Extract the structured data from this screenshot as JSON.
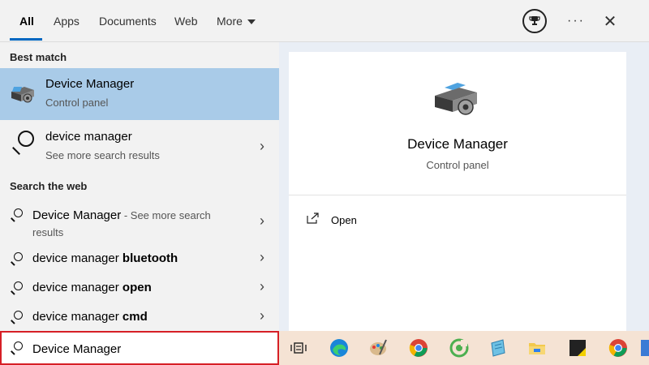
{
  "tabs": [
    {
      "label": "All",
      "active": true
    },
    {
      "label": "Apps"
    },
    {
      "label": "Documents"
    },
    {
      "label": "Web"
    },
    {
      "label": "More"
    }
  ],
  "top_icons": [
    "trophy-icon",
    "more-options-icon",
    "close-icon"
  ],
  "best_match": {
    "header": "Best match",
    "title": "Device Manager",
    "subtitle": "Control panel",
    "icon": "device-manager-icon"
  },
  "search_suggestion": {
    "title": "device manager",
    "subtitle": "See more search results"
  },
  "web": {
    "header": "Search the web",
    "items": [
      {
        "prefix": "Device Manager",
        "bold": "",
        "suffix": " - See more search",
        "line2": "results"
      },
      {
        "prefix": "device manager ",
        "bold": "bluetooth"
      },
      {
        "prefix": "device manager ",
        "bold": "open"
      },
      {
        "prefix": "device manager ",
        "bold": "cmd"
      }
    ]
  },
  "preview": {
    "title": "Device Manager",
    "subtitle": "Control panel",
    "action_open": "Open"
  },
  "search": {
    "value": "Device Manager"
  },
  "taskbar": {
    "icons": [
      "task-view-icon",
      "edge-icon",
      "paint-icon",
      "chrome-icon",
      "app-icon",
      "notepad-icon",
      "file-explorer-icon",
      "sticky-notes-icon",
      "chrome-icon-2",
      "app-icon-2"
    ]
  },
  "colors": {
    "accent": "#0067c0",
    "best_match_bg": "#a9cbe8",
    "search_border": "#d61f26",
    "taskbar": "#f5e3d4"
  }
}
